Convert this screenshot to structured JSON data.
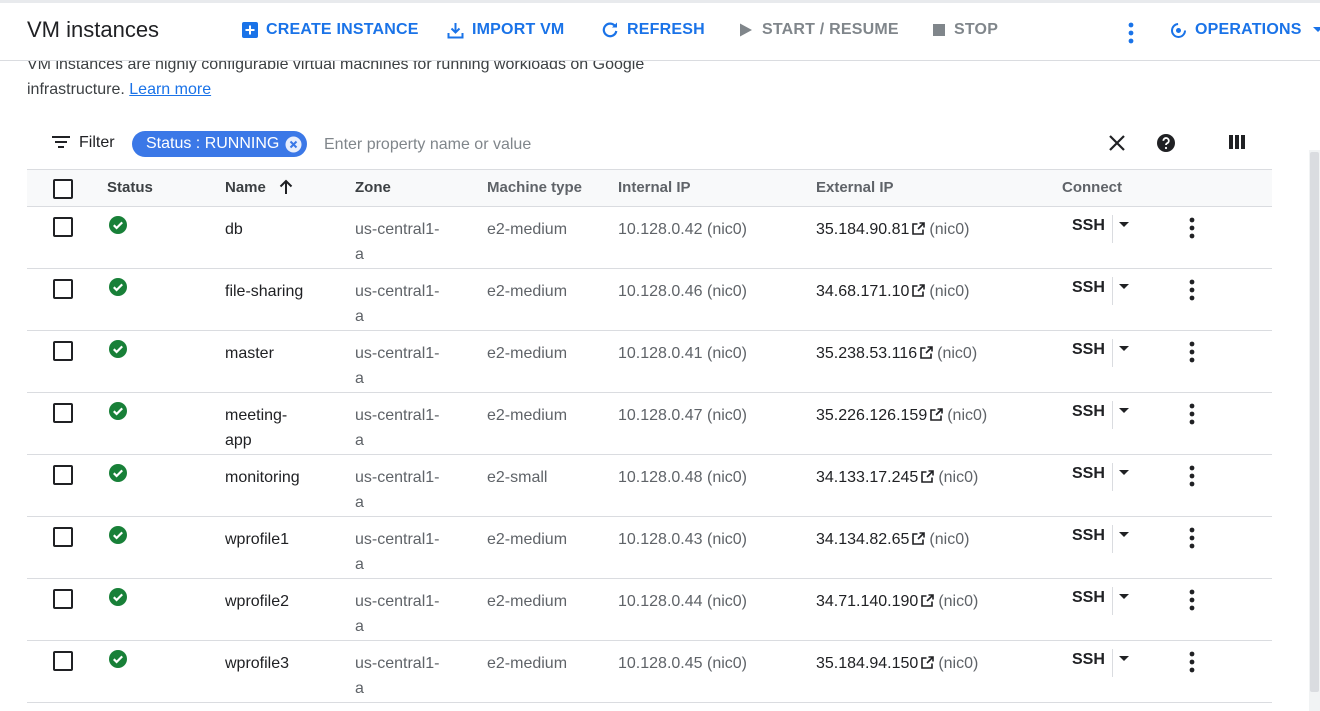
{
  "header": {
    "title": "VM instances",
    "actions": [
      {
        "label": "CREATE INSTANCE",
        "icon": "add-box-icon",
        "enabled": true
      },
      {
        "label": "IMPORT VM",
        "icon": "download-icon",
        "enabled": true
      },
      {
        "label": "REFRESH",
        "icon": "refresh-icon",
        "enabled": true
      },
      {
        "label": "START / RESUME",
        "icon": "play-icon",
        "enabled": false
      },
      {
        "label": "STOP",
        "icon": "stop-icon",
        "enabled": false
      }
    ],
    "operations_label": "OPERATIONS"
  },
  "description": {
    "text_line1": "VM instances are highly configurable virtual machines for running workloads on Google",
    "text_line2": "infrastructure.",
    "link": "Learn more"
  },
  "filter": {
    "label": "Filter",
    "chip": "Status : RUNNING",
    "placeholder": "Enter property name or value"
  },
  "columns": {
    "status": "Status",
    "name": "Name",
    "zone": "Zone",
    "machine_type": "Machine type",
    "internal_ip": "Internal IP",
    "external_ip": "External IP",
    "connect": "Connect"
  },
  "rows": [
    {
      "name_lines": [
        "db",
        ""
      ],
      "zone_lines": [
        "us-central1-",
        "a"
      ],
      "machine_type": "e2-medium",
      "internal_ip": "10.128.0.42",
      "internal_nic": "(nic0)",
      "external_ip": "35.184.90.81",
      "external_nic": "(nic0)",
      "connect": "SSH"
    },
    {
      "name_lines": [
        "file-sharing",
        ""
      ],
      "zone_lines": [
        "us-central1-",
        "a"
      ],
      "machine_type": "e2-medium",
      "internal_ip": "10.128.0.46",
      "internal_nic": "(nic0)",
      "external_ip": "34.68.171.10",
      "external_nic": "(nic0)",
      "connect": "SSH"
    },
    {
      "name_lines": [
        "master",
        ""
      ],
      "zone_lines": [
        "us-central1-",
        "a"
      ],
      "machine_type": "e2-medium",
      "internal_ip": "10.128.0.41",
      "internal_nic": "(nic0)",
      "external_ip": "35.238.53.116",
      "external_nic": "(nic0)",
      "connect": "SSH"
    },
    {
      "name_lines": [
        "meeting-",
        "app"
      ],
      "zone_lines": [
        "us-central1-",
        "a"
      ],
      "machine_type": "e2-medium",
      "internal_ip": "10.128.0.47",
      "internal_nic": "(nic0)",
      "external_ip": "35.226.126.159",
      "external_nic": "(nic0)",
      "connect": "SSH"
    },
    {
      "name_lines": [
        "monitoring",
        ""
      ],
      "zone_lines": [
        "us-central1-",
        "a"
      ],
      "machine_type": "e2-small",
      "internal_ip": "10.128.0.48",
      "internal_nic": "(nic0)",
      "external_ip": "34.133.17.245",
      "external_nic": "(nic0)",
      "connect": "SSH"
    },
    {
      "name_lines": [
        "wprofile1",
        ""
      ],
      "zone_lines": [
        "us-central1-",
        "a"
      ],
      "machine_type": "e2-medium",
      "internal_ip": "10.128.0.43",
      "internal_nic": "(nic0)",
      "external_ip": "34.134.82.65",
      "external_nic": "(nic0)",
      "connect": "SSH"
    },
    {
      "name_lines": [
        "wprofile2",
        ""
      ],
      "zone_lines": [
        "us-central1-",
        "a"
      ],
      "machine_type": "e2-medium",
      "internal_ip": "10.128.0.44",
      "internal_nic": "(nic0)",
      "external_ip": "34.71.140.190",
      "external_nic": "(nic0)",
      "connect": "SSH"
    },
    {
      "name_lines": [
        "wprofile3",
        ""
      ],
      "zone_lines": [
        "us-central1-",
        "a"
      ],
      "machine_type": "e2-medium",
      "internal_ip": "10.128.0.45",
      "internal_nic": "(nic0)",
      "external_ip": "35.184.94.150",
      "external_nic": "(nic0)",
      "connect": "SSH"
    }
  ],
  "colors": {
    "accent": "#1a73e8",
    "chip": "#3b78e7",
    "running": "#188038",
    "disabled": "#80868b"
  }
}
